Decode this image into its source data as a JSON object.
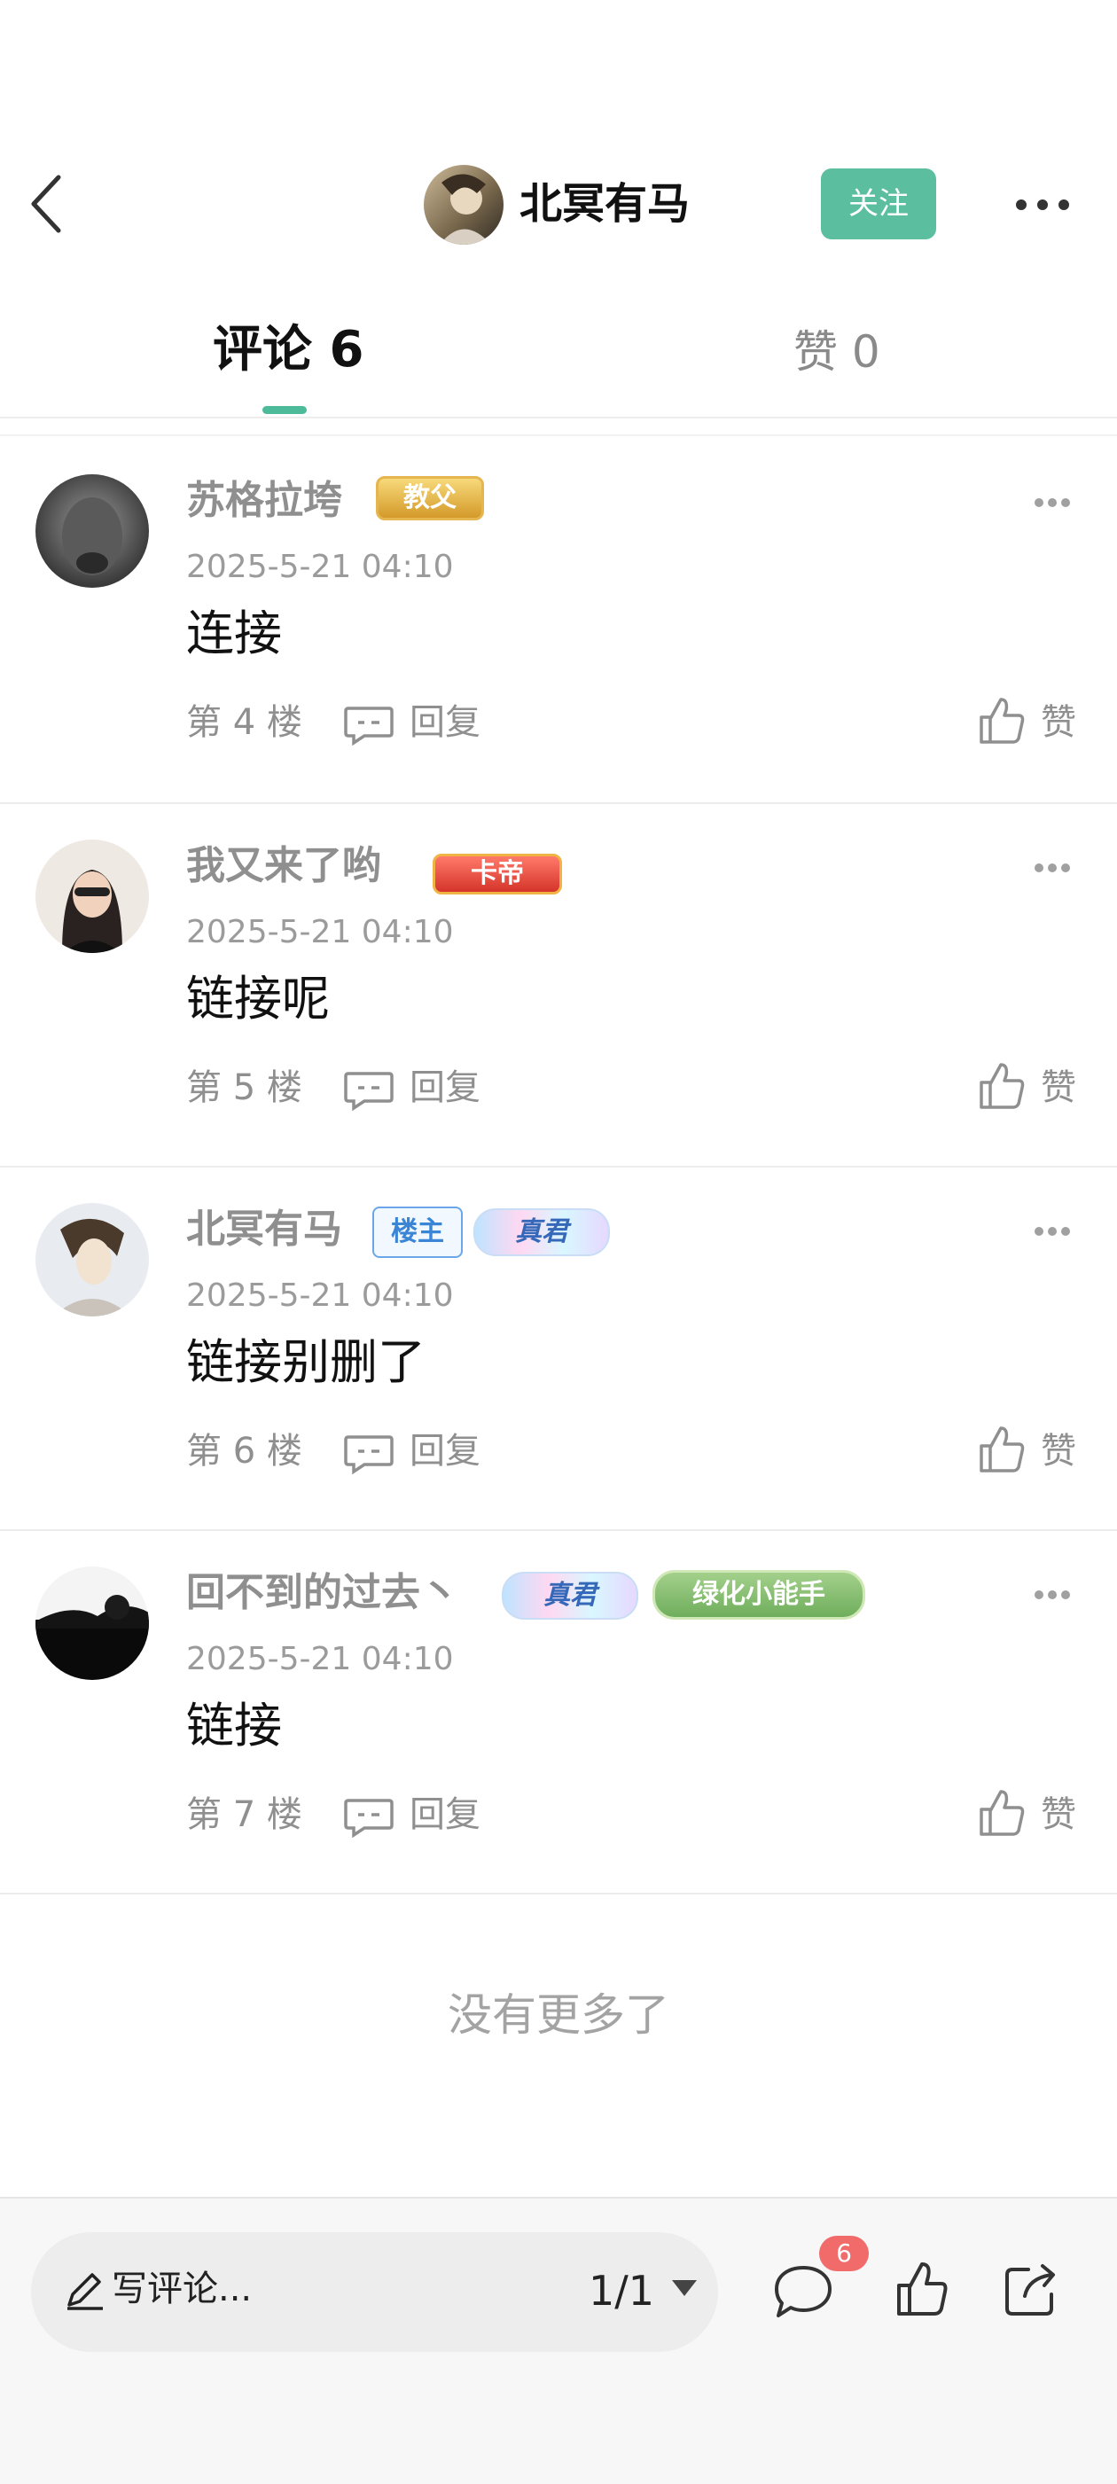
{
  "header": {
    "author_name": "北冥有马",
    "follow_label": "关注"
  },
  "tabs": {
    "comments_label": "评论 6",
    "likes_label": "赞 0"
  },
  "comments": [
    {
      "username": "苏格拉垮",
      "badges": [
        "教父"
      ],
      "timestamp": "2025-5-21 04:10",
      "content": "连接",
      "floor": "第 4 楼",
      "reply_label": "回复",
      "like_label": "赞"
    },
    {
      "username": "我又来了哟",
      "badges": [
        "卡帝"
      ],
      "timestamp": "2025-5-21 04:10",
      "content": "链接呢",
      "floor": "第 5 楼",
      "reply_label": "回复",
      "like_label": "赞"
    },
    {
      "username": "北冥有马",
      "badges": [
        "楼主",
        "真君"
      ],
      "timestamp": "2025-5-21 04:10",
      "content": "链接别删了",
      "floor": "第 6 楼",
      "reply_label": "回复",
      "like_label": "赞"
    },
    {
      "username": "回不到的过去丶",
      "badges": [
        "真君",
        "绿化小能手"
      ],
      "timestamp": "2025-5-21 04:10",
      "content": "链接",
      "floor": "第 7 楼",
      "reply_label": "回复",
      "like_label": "赞"
    }
  ],
  "footer_text": "没有更多了",
  "bottom_bar": {
    "input_placeholder": "写评论...",
    "page_indicator": "1/1",
    "comment_count": "6"
  },
  "colors": {
    "accent": "#5bbf9f",
    "badge_red": "#f26b6b"
  }
}
